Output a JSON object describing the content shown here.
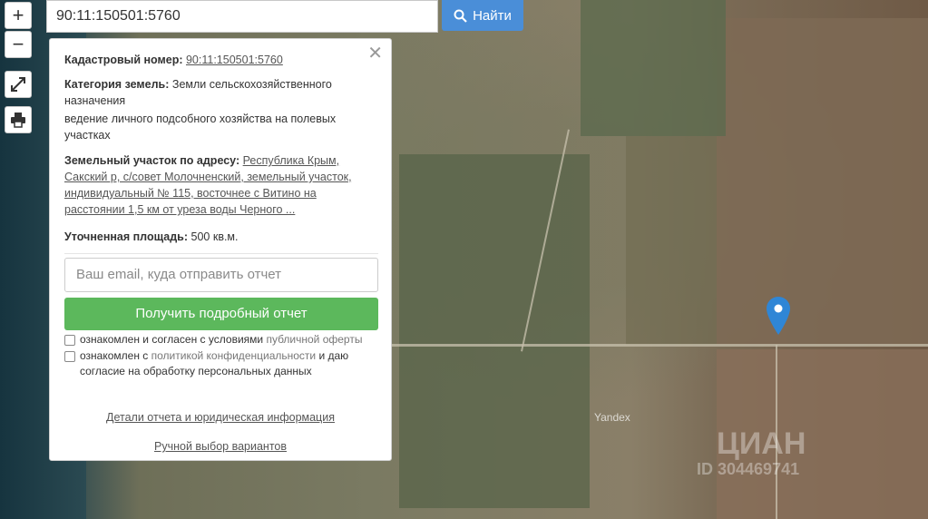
{
  "map": {
    "yandex_label": "Yandex",
    "watermark_brand": "ЦИАН",
    "watermark_id": "ID 304469741"
  },
  "controls": {
    "zoom_in": "+",
    "zoom_out": "−"
  },
  "search": {
    "value": "90:11:150501:5760",
    "button_label": "Найти"
  },
  "panel": {
    "cadastral_label": "Кадастровый номер:",
    "cadastral_value": "90:11:150501:5760",
    "category_label": "Категория земель:",
    "category_value": "Земли сельскохозяйственного назначения",
    "category_use": "ведение личного подсобного хозяйства на полевых участках",
    "address_label": "Земельный участок по адресу:",
    "address_value": "Республика Крым, Сакский р, с/совет Молочненский, земельный участок, индивидуальный № 115, восточнее с Витино на расстоянии 1,5 км от уреза воды Черного ...",
    "area_label": "Уточненная площадь:",
    "area_value": "500 кв.м.",
    "email_placeholder": "Ваш email, куда отправить отчет",
    "report_button": "Получить подробный отчет",
    "check1_text": "ознакомлен и согласен с условиями",
    "check1_link": "публичной оферты",
    "check2_text": "ознакомлен с",
    "check2_link": "политикой конфиденциальности",
    "check2_rest": "и даю согласие на обработку персональных данных",
    "details_link": "Детали отчета и юридическая информация",
    "manual_link": "Ручной выбор вариантов"
  },
  "colors": {
    "search_button": "#4a8ed8",
    "report_button": "#5cb85c",
    "pin": "#2f86d6"
  }
}
